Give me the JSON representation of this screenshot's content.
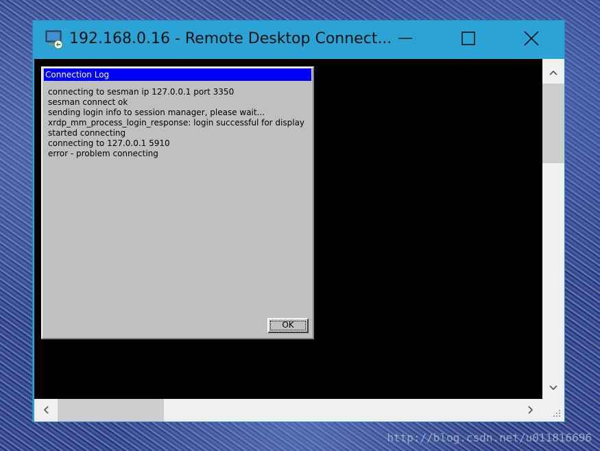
{
  "window": {
    "title": "192.168.0.16 - Remote Desktop Connect...",
    "accent_color": "#2ba3d4",
    "icons": {
      "app": "remote-desktop-icon",
      "minimize": "minimize-icon",
      "maximize": "maximize-icon",
      "close": "close-icon"
    }
  },
  "dialog": {
    "title": "Connection Log",
    "title_bar_color": "#0000ff",
    "lines": [
      "connecting to sesman ip 127.0.0.1 port 3350",
      "sesman connect ok",
      "sending login info to session manager, please wait...",
      "xrdp_mm_process_login_response: login successful for display",
      "started connecting",
      "connecting to 127.0.0.1 5910",
      "error - problem connecting"
    ],
    "ok_label": "OK"
  },
  "scrollbars": {
    "vertical_icons": [
      "chevron-up-icon",
      "chevron-down-icon"
    ],
    "horizontal_icons": [
      "chevron-left-icon",
      "chevron-right-icon"
    ]
  },
  "watermark": "http://blog.csdn.net/u011816696"
}
